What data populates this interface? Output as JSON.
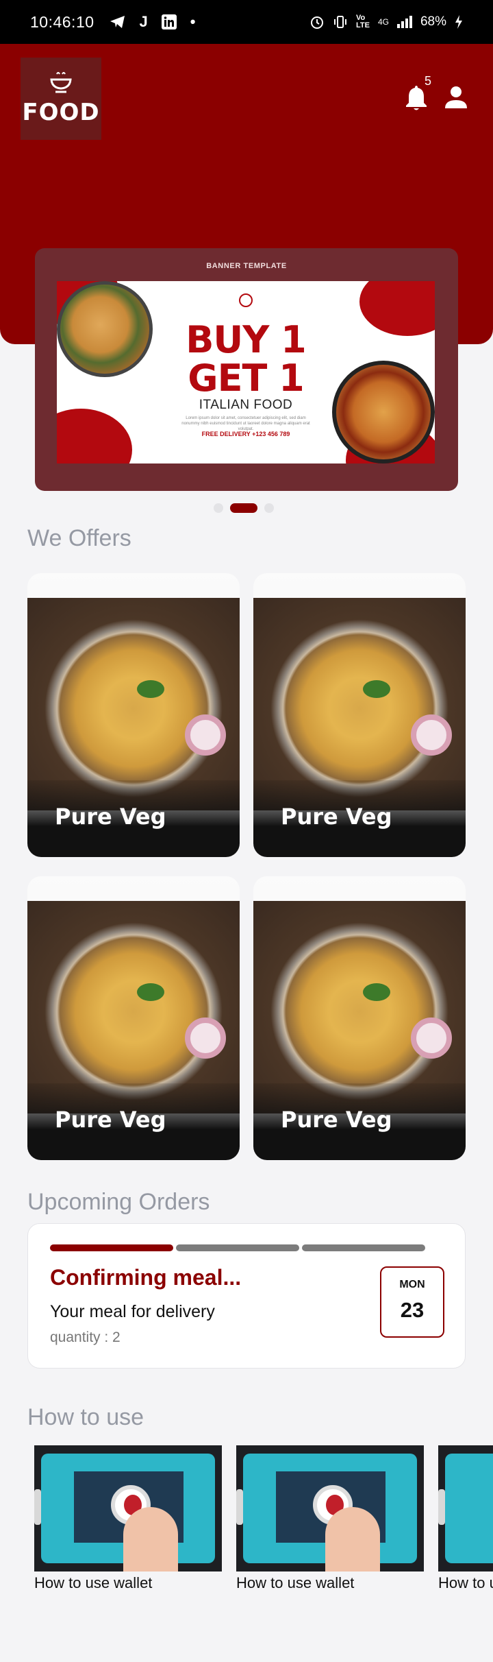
{
  "status_bar": {
    "time": "10:46:10",
    "icons": [
      "telegram-icon",
      "j-app-icon",
      "linkedin-icon",
      "dot-icon"
    ],
    "right_icons": [
      "alarm-icon",
      "vibrate-icon",
      "volte-icon",
      "signal-icon",
      "battery-charging-icon"
    ],
    "volte_label": "Vo LTE",
    "network_label": "4G",
    "battery": "68%"
  },
  "header": {
    "logo_text": "FOOD",
    "notification_count": "5",
    "colors": {
      "primary": "#8b0000",
      "accent": "#b3090f"
    }
  },
  "banner": {
    "label": "BANNER TEMPLATE",
    "headline_1": "BUY 1",
    "headline_2": "GET 1",
    "subheadline": "ITALIAN FOOD",
    "body": "Lorem ipsum dolor sit amet, consectetuer adipiscing elit, sed diam nonummy nibh euismod tincidunt ut laoreet dolore magna aliquam erat volutpat.",
    "delivery": "FREE DELIVERY +123 456 789",
    "carousel": {
      "count": 3,
      "active_index": 1
    }
  },
  "offers": {
    "title": "We Offers",
    "items": [
      {
        "label": "Pure Veg"
      },
      {
        "label": "Pure Veg"
      },
      {
        "label": "Pure Veg"
      },
      {
        "label": "Pure Veg"
      }
    ]
  },
  "upcoming": {
    "title": "Upcoming Orders",
    "progress": {
      "steps": 3,
      "completed": 1
    },
    "status": "Confirming meal...",
    "subtitle": "Your meal for delivery",
    "quantity": "quantity : 2",
    "day": "MON",
    "date": "23"
  },
  "how_to": {
    "title": "How to use",
    "videos": [
      {
        "title": "How to use wallet"
      },
      {
        "title": "How to use wallet"
      },
      {
        "title": "How to use wallet"
      }
    ]
  }
}
